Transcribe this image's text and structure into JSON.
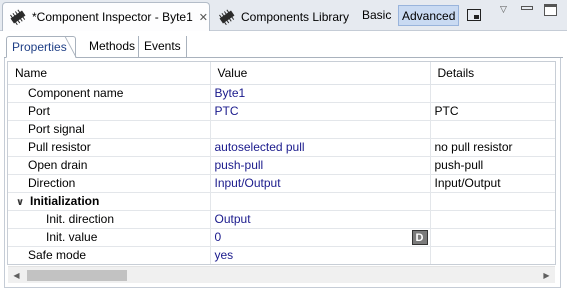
{
  "topbar": {
    "active_tab": {
      "title": "*Component Inspector - Byte1",
      "icon": "component-inspector-icon",
      "close": "✕"
    },
    "inactive_tab": {
      "title": "Components Library",
      "icon": "components-library-icon"
    },
    "mode_basic": "Basic",
    "mode_advanced": "Advanced"
  },
  "subtabs": [
    "Properties",
    "Methods",
    "Events"
  ],
  "table": {
    "headers": [
      "Name",
      "Value",
      "Details"
    ],
    "rows": [
      {
        "name": "Component name",
        "value": "Byte1",
        "details": ""
      },
      {
        "name": "Port",
        "value": "PTC",
        "details": "PTC"
      },
      {
        "name": "Port signal",
        "value": "",
        "details": ""
      },
      {
        "name": "Pull resistor",
        "value": "autoselected pull",
        "details": "no pull resistor"
      },
      {
        "name": "Open drain",
        "value": "push-pull",
        "details": "push-pull"
      },
      {
        "name": "Direction",
        "value": "Input/Output",
        "details": "Input/Output"
      },
      {
        "name": "Initialization",
        "value": "",
        "details": ""
      },
      {
        "name": "Init. direction",
        "value": "Output",
        "details": ""
      },
      {
        "name": "Init. value",
        "value": "0",
        "details": "",
        "button": "D"
      },
      {
        "name": "Safe mode",
        "value": "yes",
        "details": ""
      }
    ]
  },
  "scrollbar": {
    "left_arrow": "◀",
    "right_arrow": "▶"
  }
}
